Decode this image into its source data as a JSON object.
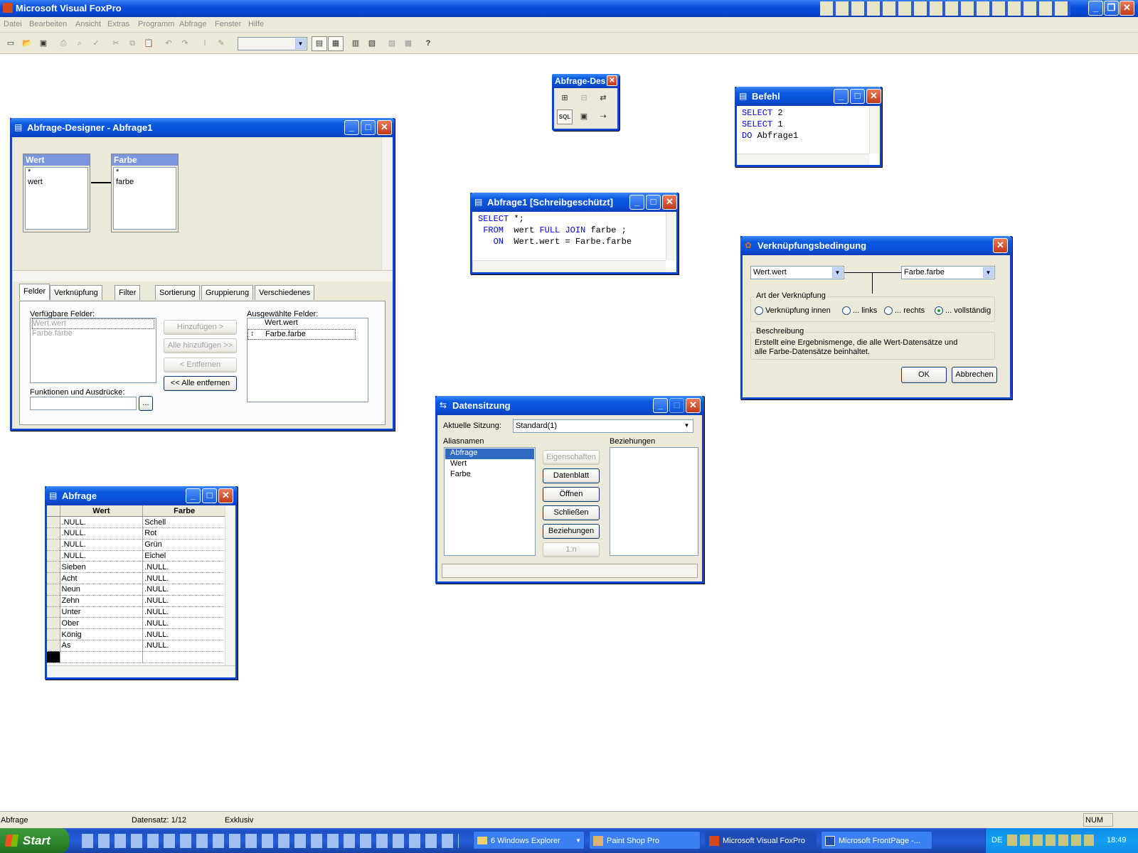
{
  "app": {
    "title": "Microsoft Visual FoxPro"
  },
  "menu": [
    "Datei",
    "Bearbeiten",
    "Ansicht",
    "Extras",
    "Programm",
    "Abfrage",
    "Fenster",
    "Hilfe"
  ],
  "toolbar": {
    "help_glyph": "?"
  },
  "query_toolbar": {
    "title": "Abfrage-Des",
    "sql_label": "SQL"
  },
  "designer": {
    "title": "Abfrage-Designer - Abfrage1",
    "tables": [
      {
        "name": "Wert",
        "fields": [
          "*",
          "wert"
        ]
      },
      {
        "name": "Farbe",
        "fields": [
          "*",
          "farbe"
        ]
      }
    ],
    "tabs": [
      "Felder",
      "Verknüpfung",
      "Filter",
      "Sortierung",
      "Gruppierung",
      "Verschiedenes"
    ],
    "available_label": "Verfügbare Felder:",
    "available": [
      "Wert.wert",
      "Farbe.farbe"
    ],
    "selected_label": "Ausgewählte Felder:",
    "selected": [
      "Wert.wert",
      "Farbe.farbe"
    ],
    "functions_label": "Funktionen und Ausdrücke:",
    "ellipsis": "...",
    "buttons": {
      "add": "Hinzufügen >",
      "add_all": "Alle hinzufügen >>",
      "remove": "< Entfernen",
      "remove_all": "<< Alle entfernen"
    }
  },
  "befehl": {
    "title": "Befehl",
    "lines": [
      {
        "kw": "SELECT",
        "rest": " 2"
      },
      {
        "kw": "SELECT",
        "rest": " 1"
      },
      {
        "kw": "DO",
        "rest": " Abfrage1"
      }
    ]
  },
  "sql_window": {
    "title": "Abfrage1 [Schreibgeschützt]",
    "lines": [
      [
        {
          "k": true,
          "t": "SELECT"
        },
        {
          "k": false,
          "t": " *;"
        }
      ],
      [
        {
          "k": false,
          "t": " "
        },
        {
          "k": true,
          "t": "FROM"
        },
        {
          "k": false,
          "t": "  wert "
        },
        {
          "k": true,
          "t": "FULL JOIN"
        },
        {
          "k": false,
          "t": " farbe ;"
        }
      ],
      [
        {
          "k": false,
          "t": "   "
        },
        {
          "k": true,
          "t": "ON"
        },
        {
          "k": false,
          "t": "  Wert.wert = Farbe.farbe"
        }
      ]
    ]
  },
  "join_dialog": {
    "title": "Verknüpfungsbedingung",
    "left_field": "Wert.wert",
    "right_field": "Farbe.farbe",
    "group_type": "Art der Verknüpfung",
    "options": [
      "Verknüpfung innen",
      "... links",
      "... rechts",
      "... vollständig"
    ],
    "selected_option": 3,
    "group_desc": "Beschreibung",
    "description": "Erstellt eine Ergebnismenge, die alle Wert-Datensätze und alle Farbe-Datensätze beinhaltet.",
    "ok": "OK",
    "cancel": "Abbrechen"
  },
  "datasession": {
    "title": "Datensitzung",
    "session_label": "Aktuelle Sitzung:",
    "session_value": "Standard(1)",
    "aliases_label": "Aliasnamen",
    "aliases": [
      "Abfrage",
      "Wert",
      "Farbe"
    ],
    "relations_label": "Beziehungen",
    "buttons": [
      "Eigenschaften",
      "Datenblatt",
      "Öffnen",
      "Schließen",
      "Beziehungen",
      "1:n"
    ]
  },
  "browse": {
    "title": "Abfrage",
    "columns": [
      "Wert",
      "Farbe"
    ],
    "rows": [
      [
        ".NULL.",
        "Schell"
      ],
      [
        ".NULL.",
        "Rot"
      ],
      [
        ".NULL.",
        "Grün"
      ],
      [
        ".NULL.",
        "Eichel"
      ],
      [
        "Sieben",
        ".NULL."
      ],
      [
        "Acht",
        ".NULL."
      ],
      [
        "Neun",
        ".NULL."
      ],
      [
        "Zehn",
        ".NULL."
      ],
      [
        "Unter",
        ".NULL."
      ],
      [
        "Ober",
        ".NULL."
      ],
      [
        "König",
        ".NULL."
      ],
      [
        "As",
        ".NULL."
      ]
    ]
  },
  "status": {
    "alias": "Abfrage",
    "record": "Datensatz: 1/12",
    "mode": "Exklusiv",
    "num": "NUM"
  },
  "taskbar": {
    "start": "Start",
    "tasks": [
      "6 Windows Explorer",
      "Paint Shop Pro",
      "Microsoft Visual FoxPro",
      "Microsoft FrontPage -..."
    ],
    "lang": "DE",
    "clock": "18:49"
  }
}
